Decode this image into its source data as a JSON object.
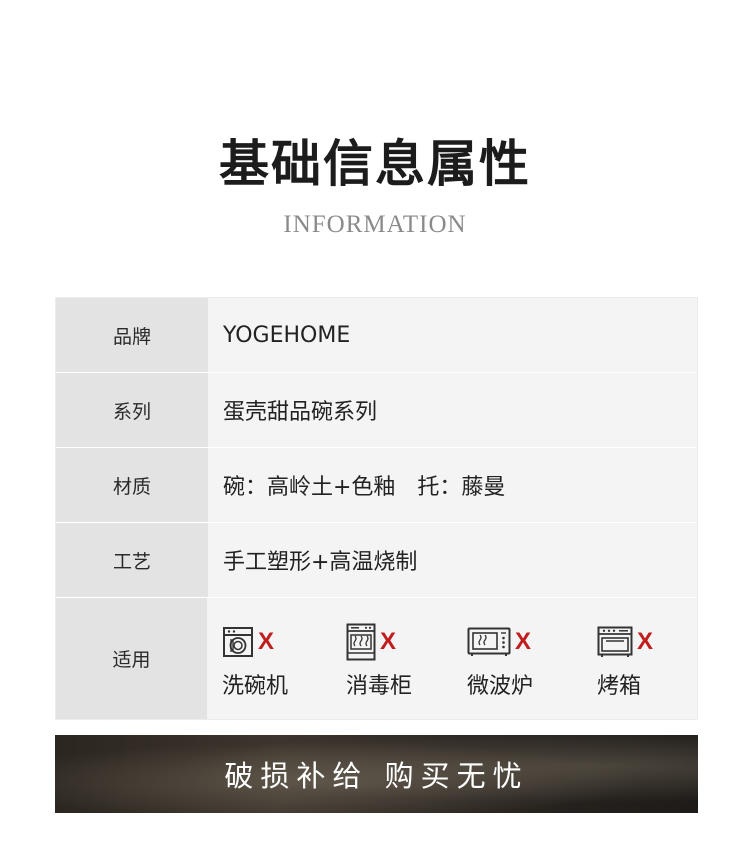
{
  "header": {
    "title": "基础信息属性",
    "subtitle": "INFORMATION"
  },
  "table": {
    "rows": [
      {
        "label": "品牌",
        "value": "YOGEHOME"
      },
      {
        "label": "系列",
        "value": "蛋壳甜品碗系列"
      },
      {
        "label": "材质",
        "value": "碗：高岭土+色釉　托：藤曼"
      },
      {
        "label": "工艺",
        "value": "手工塑形+高温烧制"
      },
      {
        "label": "适用"
      }
    ],
    "uses": [
      {
        "name": "洗碗机",
        "icon": "dishwasher-icon",
        "mark": "X"
      },
      {
        "name": "消毒柜",
        "icon": "sterilizer-icon",
        "mark": "X"
      },
      {
        "name": "微波炉",
        "icon": "microwave-icon",
        "mark": "X"
      },
      {
        "name": "烤箱",
        "icon": "oven-icon",
        "mark": "X"
      }
    ]
  },
  "banner": {
    "text": "破损补给 购买无忧"
  },
  "colors": {
    "label_bg": "#e3e3e3",
    "value_bg": "#f4f4f4",
    "x_mark": "#c01e1e"
  }
}
